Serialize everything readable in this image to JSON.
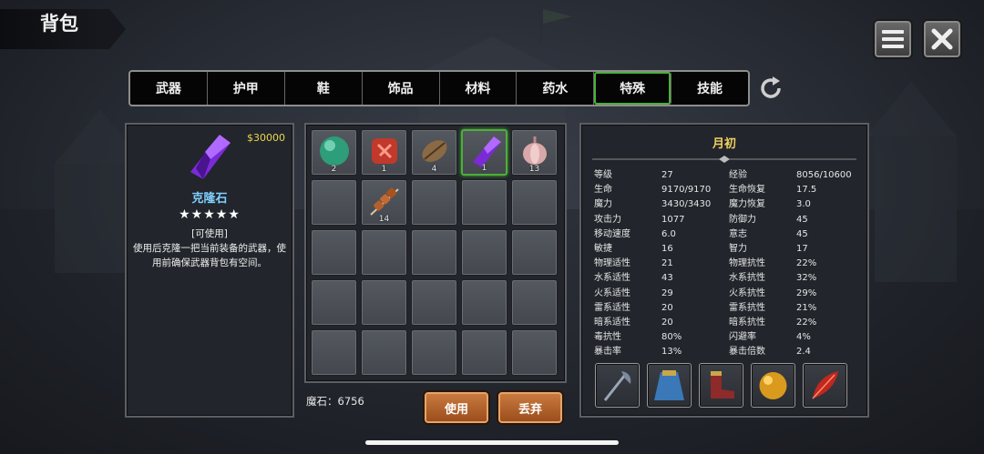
{
  "header": {
    "title": "背包"
  },
  "top_buttons": {
    "menu_icon": "menu-icon",
    "close_icon": "close-icon"
  },
  "tabs": [
    {
      "label": "武器"
    },
    {
      "label": "护甲"
    },
    {
      "label": "鞋"
    },
    {
      "label": "饰品"
    },
    {
      "label": "材料"
    },
    {
      "label": "药水"
    },
    {
      "label": "特殊",
      "active": true
    },
    {
      "label": "技能"
    }
  ],
  "selected_item": {
    "price": "$30000",
    "name": "克隆石",
    "stars": "★★★★★",
    "usable": "[可使用]",
    "description": "使用后克隆一把当前装备的武器，使用前确保武器背包有空间。"
  },
  "inventory": {
    "slots": [
      {
        "icon": "green-orb-icon",
        "qty": "2"
      },
      {
        "icon": "red-rune-icon",
        "qty": "1"
      },
      {
        "icon": "brown-seed-icon",
        "qty": "4"
      },
      {
        "icon": "purple-crystal-icon",
        "qty": "1",
        "selected": true
      },
      {
        "icon": "garlic-icon",
        "qty": "13"
      },
      {
        "icon": "empty",
        "qty": ""
      },
      {
        "icon": "meat-skewer-icon",
        "qty": "14"
      }
    ],
    "magic_stone_label": "魔石：6756"
  },
  "actions": {
    "use_label": "使用",
    "discard_label": "丢弃"
  },
  "character": {
    "name": "月初",
    "stats": [
      [
        "等级",
        "27",
        "经验",
        "8056/10600"
      ],
      [
        "生命",
        "9170/9170",
        "生命恢复",
        "17.5"
      ],
      [
        "魔力",
        "3430/3430",
        "魔力恢复",
        "3.0"
      ],
      [
        "攻击力",
        "1077",
        "防御力",
        "45"
      ],
      [
        "移动速度",
        "6.0",
        "意志",
        "45"
      ],
      [
        "敏捷",
        "16",
        "智力",
        "17"
      ],
      [
        "物理适性",
        "21",
        "物理抗性",
        "22%"
      ],
      [
        "水系适性",
        "43",
        "水系抗性",
        "32%"
      ],
      [
        "火系适性",
        "29",
        "火系抗性",
        "29%"
      ],
      [
        "雷系适性",
        "20",
        "雷系抗性",
        "21%"
      ],
      [
        "暗系适性",
        "20",
        "暗系抗性",
        "22%"
      ],
      [
        "毒抗性",
        "80%",
        "闪避率",
        "4%"
      ],
      [
        "暴击率",
        "13%",
        "暴击倍数",
        "2.4"
      ]
    ],
    "equipment": [
      "axe-weapon-icon",
      "blue-cloak-icon",
      "red-boots-icon",
      "gold-orb-icon",
      "red-feather-icon"
    ]
  },
  "colors": {
    "accent_green": "#4caf3a",
    "price_gold": "#e9d84a",
    "item_name": "#7fd0ff",
    "button_orange": "#b5632c"
  }
}
